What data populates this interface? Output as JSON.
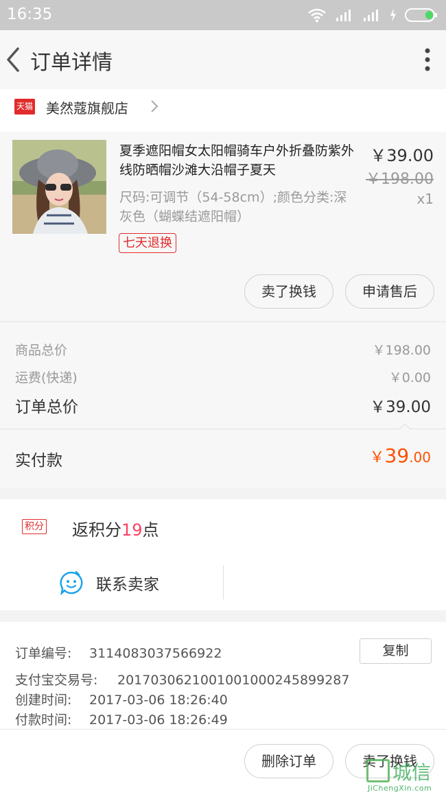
{
  "status_bar": {
    "time": "16:35"
  },
  "nav": {
    "title": "订单详情"
  },
  "shop": {
    "badge": "天猫",
    "name": "美然蔻旗舰店"
  },
  "product": {
    "title": "夏季遮阳帽女太阳帽骑车户外折叠防紫外线防晒帽沙滩大沿帽子夏天",
    "sku": "尺码:可调节（54-58cm）;颜色分类:深灰色（蝴蝶结遮阳帽）",
    "return_tag": "七天退换",
    "price": "￥39.00",
    "original_price": "￥198.00",
    "quantity": "x1",
    "btn_sell": "卖了换钱",
    "btn_aftersale": "申请售后"
  },
  "totals": {
    "goods_label": "商品总价",
    "goods_value": "￥198.00",
    "shipping_label": "运费(快递)",
    "shipping_value": "￥0.00",
    "order_label": "订单总价",
    "order_value": "￥39.00"
  },
  "paid": {
    "label": "实付款",
    "currency": "￥",
    "integer": "39",
    "decimal": ".00"
  },
  "points": {
    "badge": "积分",
    "prefix": "返积分",
    "number": "19",
    "suffix": "点"
  },
  "contact": {
    "label": "联系卖家"
  },
  "order_info": {
    "order_no_label": "订单编号:",
    "order_no": "3114083037566922",
    "alipay_label": "支付宝交易号:",
    "alipay_no": "2017030621001001000245899287",
    "created_label": "创建时间:",
    "created_time": "2017-03-06 18:26:40",
    "paid_label": "付款时间:",
    "paid_time": "2017-03-06 18:26:49",
    "copy_label": "复制"
  },
  "bottom": {
    "btn_delete": "删除订单",
    "btn_sell": "卖了换钱"
  },
  "watermark": {
    "text": "城信",
    "url": "JiChengXin.com"
  },
  "colors": {
    "accent": "#ff5000",
    "tmall_red": "#e22b2b",
    "points_pink": "#ff4060",
    "contact_blue": "#1aa3e8"
  }
}
